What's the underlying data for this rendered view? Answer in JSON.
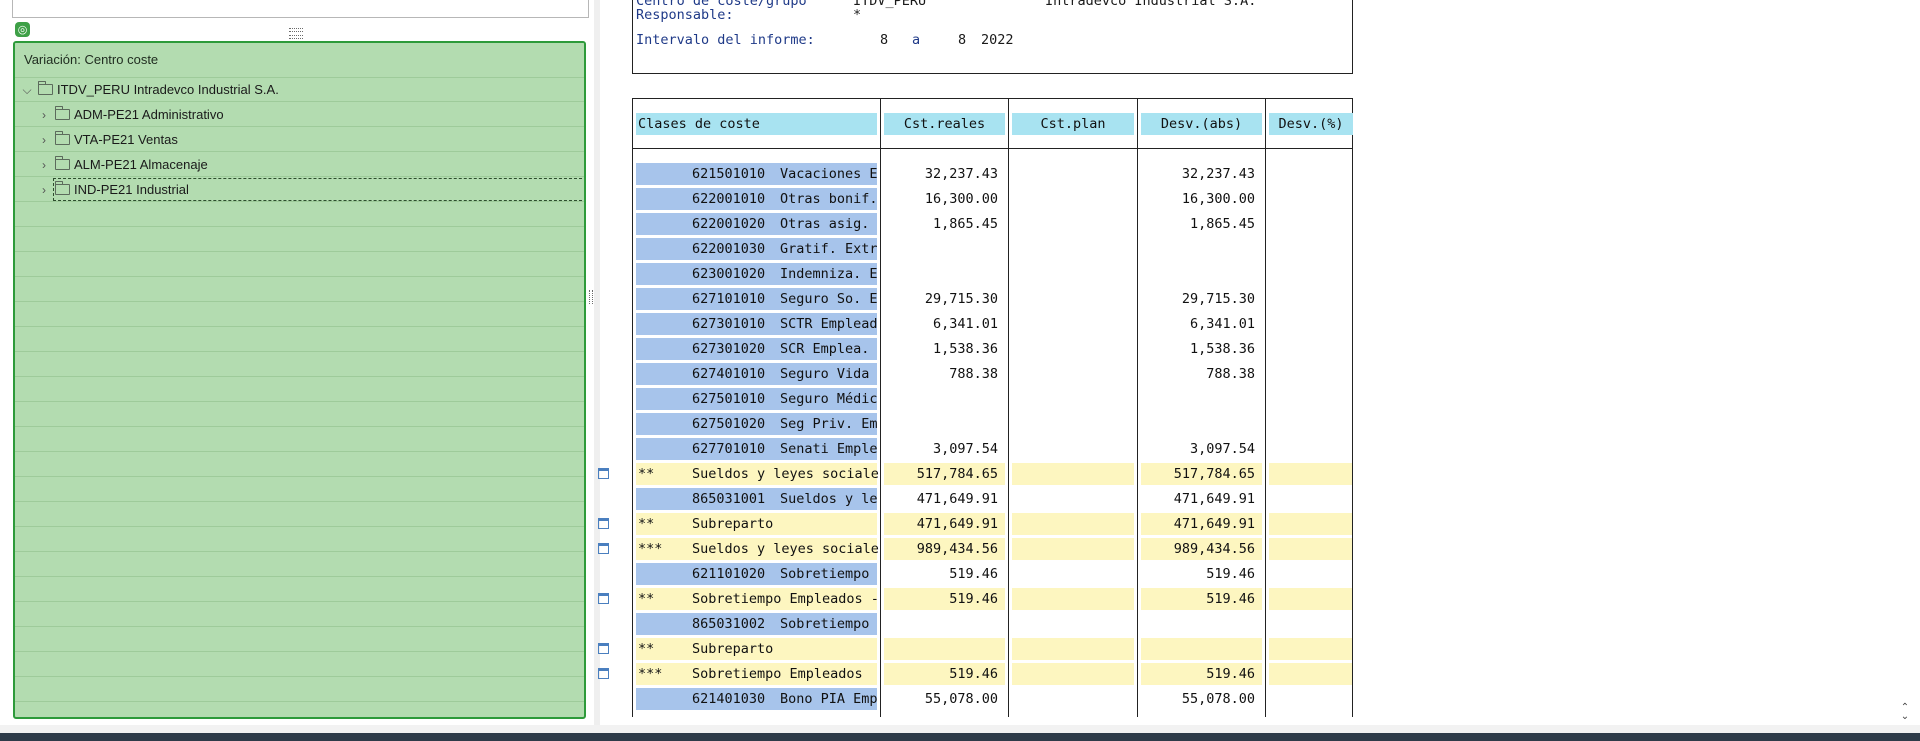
{
  "tree": {
    "panel_title": "Variación: Centro coste",
    "root": {
      "label": "ITDV_PERU Intradevco Industrial S.A.",
      "expanded": true
    },
    "children": [
      {
        "label": "ADM-PE21 Administrativo"
      },
      {
        "label": "VTA-PE21 Ventas"
      },
      {
        "label": "ALM-PE21 Almacenaje"
      },
      {
        "label": "IND-PE21 Industrial",
        "selected": true
      }
    ]
  },
  "report_header": {
    "cost_center_label": "Centro de coste/grupo",
    "cost_center_value": "ITDV_PERU",
    "company_value": "Intradevco Industrial S.A.",
    "responsible_label": "Responsable:",
    "responsible_value": "*",
    "interval_label": "Intervalo del informe:",
    "interval_from": "8",
    "interval_sep": "a",
    "interval_to": "8",
    "interval_year": "2022"
  },
  "columns": [
    "Clases de coste",
    "Cst.reales",
    "Cst.plan",
    "Desv.(abs)",
    "Desv.(%)"
  ],
  "rows": [
    {
      "type": "item",
      "code": "621501010",
      "name": "Vacaciones E",
      "actual": "32,237.43",
      "plan": "",
      "dev_abs": "32,237.43",
      "dev_pct": ""
    },
    {
      "type": "item",
      "code": "622001010",
      "name": "Otras bonif.",
      "actual": "16,300.00",
      "plan": "",
      "dev_abs": "16,300.00",
      "dev_pct": ""
    },
    {
      "type": "item",
      "code": "622001020",
      "name": "Otras asig.",
      "actual": "1,865.45",
      "plan": "",
      "dev_abs": "1,865.45",
      "dev_pct": ""
    },
    {
      "type": "item",
      "code": "622001030",
      "name": "Gratif. Extr",
      "actual": "",
      "plan": "",
      "dev_abs": "",
      "dev_pct": ""
    },
    {
      "type": "item",
      "code": "623001020",
      "name": "Indemniza. E",
      "actual": "",
      "plan": "",
      "dev_abs": "",
      "dev_pct": ""
    },
    {
      "type": "item",
      "code": "627101010",
      "name": "Seguro So. E",
      "actual": "29,715.30",
      "plan": "",
      "dev_abs": "29,715.30",
      "dev_pct": ""
    },
    {
      "type": "item",
      "code": "627301010",
      "name": "SCTR Emplead",
      "actual": "6,341.01",
      "plan": "",
      "dev_abs": "6,341.01",
      "dev_pct": ""
    },
    {
      "type": "item",
      "code": "627301020",
      "name": "SCR Emplea.",
      "actual": "1,538.36",
      "plan": "",
      "dev_abs": "1,538.36",
      "dev_pct": ""
    },
    {
      "type": "item",
      "code": "627401010",
      "name": "Seguro Vida",
      "actual": "788.38",
      "plan": "",
      "dev_abs": "788.38",
      "dev_pct": ""
    },
    {
      "type": "item",
      "code": "627501010",
      "name": "Seguro Médic",
      "actual": "",
      "plan": "",
      "dev_abs": "",
      "dev_pct": ""
    },
    {
      "type": "item",
      "code": "627501020",
      "name": "Seg Priv. Em",
      "actual": "",
      "plan": "",
      "dev_abs": "",
      "dev_pct": ""
    },
    {
      "type": "item",
      "code": "627701010",
      "name": "Senati Emple",
      "actual": "3,097.54",
      "plan": "",
      "dev_abs": "3,097.54",
      "dev_pct": ""
    },
    {
      "type": "sum",
      "stars": "**",
      "name": "Sueldos y leyes sociale",
      "actual": "517,784.65",
      "plan": "",
      "dev_abs": "517,784.65",
      "dev_pct": ""
    },
    {
      "type": "item",
      "code": "865031001",
      "name": "Sueldos y le",
      "actual": "471,649.91",
      "plan": "",
      "dev_abs": "471,649.91",
      "dev_pct": ""
    },
    {
      "type": "sum",
      "stars": "**",
      "name": "Subreparto",
      "actual": "471,649.91",
      "plan": "",
      "dev_abs": "471,649.91",
      "dev_pct": ""
    },
    {
      "type": "sum",
      "stars": "***",
      "name": "Sueldos y leyes sociale",
      "actual": "989,434.56",
      "plan": "",
      "dev_abs": "989,434.56",
      "dev_pct": ""
    },
    {
      "type": "item",
      "code": "621101020",
      "name": "Sobretiempo",
      "actual": "519.46",
      "plan": "",
      "dev_abs": "519.46",
      "dev_pct": ""
    },
    {
      "type": "sum",
      "stars": "**",
      "name": "Sobretiempo Empleados -",
      "actual": "519.46",
      "plan": "",
      "dev_abs": "519.46",
      "dev_pct": ""
    },
    {
      "type": "item",
      "code": "865031002",
      "name": "Sobretiempo",
      "actual": "",
      "plan": "",
      "dev_abs": "",
      "dev_pct": ""
    },
    {
      "type": "sum",
      "stars": "**",
      "name": "Subreparto",
      "actual": "",
      "plan": "",
      "dev_abs": "",
      "dev_pct": ""
    },
    {
      "type": "sum",
      "stars": "***",
      "name": "Sobretiempo Empleados",
      "actual": "519.46",
      "plan": "",
      "dev_abs": "519.46",
      "dev_pct": ""
    },
    {
      "type": "item",
      "code": "621401030",
      "name": "Bono PIA Emp",
      "actual": "55,078.00",
      "plan": "",
      "dev_abs": "55,078.00",
      "dev_pct": ""
    }
  ],
  "colors": {
    "tree_bg": "#b3dcb0",
    "tree_border": "#2d9a3a",
    "header_cyan": "#a8e3f1",
    "code_blue": "#a7c4eb",
    "sum_yellow": "#fdf6c0",
    "label_blue": "#1f3a88"
  },
  "icons": {
    "tree_toggle": "tree-toggle-icon",
    "folder": "folder-icon",
    "sum_row": "sum-row-icon"
  }
}
